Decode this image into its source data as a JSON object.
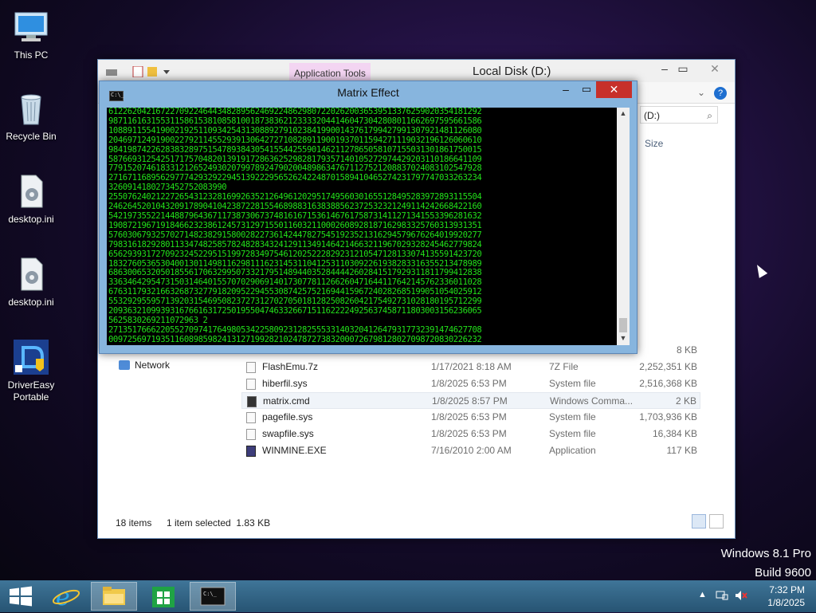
{
  "desktop": {
    "icons": [
      {
        "label": "This PC"
      },
      {
        "label": "Recycle Bin"
      },
      {
        "label": "desktop.ini"
      },
      {
        "label": "desktop.ini"
      },
      {
        "label": "DriverEasy Portable"
      }
    ]
  },
  "explorer": {
    "app_tools": "Application Tools",
    "title": "Local Disk (D:)",
    "address_value": "(D:)",
    "column_size": "Size",
    "help": "?",
    "nav_network": "Network",
    "partial_size": "8 KB",
    "files": [
      {
        "name": "FlashEmu.7z",
        "date": "1/17/2021 8:18 AM",
        "type": "7Z File",
        "size": "2,252,351 KB"
      },
      {
        "name": "hiberfil.sys",
        "date": "1/8/2025 6:53 PM",
        "type": "System file",
        "size": "2,516,368 KB"
      },
      {
        "name": "matrix.cmd",
        "date": "1/8/2025 8:57 PM",
        "type": "Windows Comma...",
        "size": "2 KB"
      },
      {
        "name": "pagefile.sys",
        "date": "1/8/2025 6:53 PM",
        "type": "System file",
        "size": "1,703,936 KB"
      },
      {
        "name": "swapfile.sys",
        "date": "1/8/2025 6:53 PM",
        "type": "System file",
        "size": "16,384 KB"
      },
      {
        "name": "WINMINE.EXE",
        "date": "7/16/2010 2:00 AM",
        "type": "Application",
        "size": "117 KB"
      }
    ],
    "status_items": "18 items",
    "status_selected": "1 item selected  1.83 KB"
  },
  "console": {
    "title": "Matrix Effect",
    "icon_text": "C:\\_",
    "lines": [
      "6122620421672270922464434828956246922486298072202620036539513376259020354181292",
      "9871161631553115861538108581001873836212333320441460473042808011662697595661586",
      "1088911554190021925110934254313088927910238419900143761799427991307921481126080",
      "2046971249190022792114552939130642727108289119001937011594271119032196126060610",
      "9841987422628383289751547893843054155442559014621127865058107155031301861750015",
      "5876693125425171757048201391917286362529828179357140105272974429203110186641109",
      "7791520746183312126524930207997892479020048986347671127521208837024083102547928",
      "2716711689562977742932922945139222956526242248701589410465274231797747033263234",
      "3260914180273452752083990",
      "2550762402122726543123281699263521264961202951749560301655128495283972893115504",
      "2462645201043209178904104238722815546898831638388562372532321249114242668422160",
      "5421973552214488796436711738730673748161671536146761758731411271341553396281632",
      "1908721967191846623238612457312971550116032110002608928187162983325760313931351",
      "5760306793257027148238291580028227361424478275451923521316294579676264019920277",
      "7983161829280113347482585782482834324129113491464214663211967029328245462779824",
      "6562939317270923245229515199728349754612025222829231210547128133074135591423720",
      "1832760536530400130114981162981116231453110412531103092261938283316355213478989",
      "6863006532050185561706329950733217951489440352844442602841517929311811799412838",
      "3363464295473150314640155707029069140173077811266260471644117642145762336011028",
      "6763117932166326873277918209522945530874257521694415967240282685199051054025912",
      "5532929559571392031546950823727312702705018128250826042175492731028180195712299",
      "2093632109939316766163172501955047463326671511622224925637458711803003156236065",
      "5625830269211072963 2",
      "2713517666220552709741764980534225809231282555331403204126479317732391474627708",
      "0097256971935116089859824131271992821024787273832000726798128027098720830226232"
    ]
  },
  "taskbar": {
    "clock_time": "7:32 PM",
    "clock_date": "1/8/2025"
  },
  "watermark": {
    "line1": "Windows 8.1 Pro",
    "line2": "Build 9600"
  }
}
